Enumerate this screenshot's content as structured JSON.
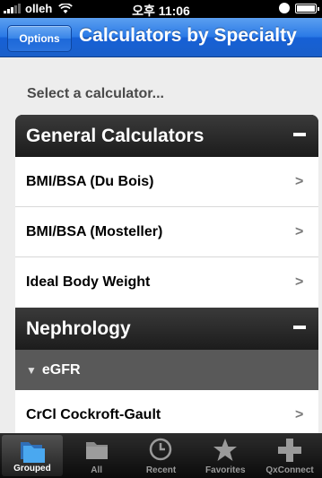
{
  "status_bar": {
    "carrier": "olleh",
    "time": "오후 11:06"
  },
  "nav": {
    "left_button": "Options",
    "title": "Calculators by Specialty"
  },
  "prompt": "Select a calculator...",
  "sections": [
    {
      "title": "General Calculators",
      "items": [
        "BMI/BSA (Du Bois)",
        "BMI/BSA (Mosteller)",
        "Ideal Body Weight"
      ]
    },
    {
      "title": "Nephrology",
      "group": "eGFR",
      "items": [
        "CrCl Cockroft-Gault"
      ]
    }
  ],
  "tabs": [
    {
      "label": "Grouped",
      "icon": "folders-icon",
      "selected": true
    },
    {
      "label": "All",
      "icon": "folder-icon",
      "selected": false
    },
    {
      "label": "Recent",
      "icon": "clock-icon",
      "selected": false
    },
    {
      "label": "Favorites",
      "icon": "star-icon",
      "selected": false
    },
    {
      "label": "QxConnect",
      "icon": "plus-icon",
      "selected": false
    }
  ],
  "colors": {
    "nav_blue": "#2b7ae6",
    "section_dark": "#222222",
    "group_gray": "#595959",
    "tab_selected_icon": "#4aa8f0"
  }
}
